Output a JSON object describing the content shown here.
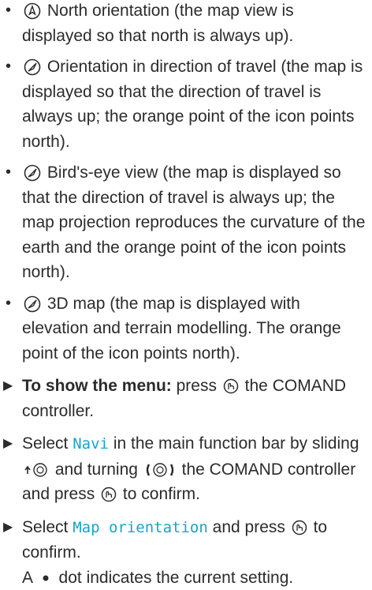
{
  "bullets": [
    {
      "icon": "north-orientation-icon",
      "text": "North orientation (the map view is displayed so that north is always up)."
    },
    {
      "icon": "compass-icon",
      "text": "Orientation in direction of travel (the map is displayed so that the direction of travel is always up; the orange point of the icon points north)."
    },
    {
      "icon": "compass-icon",
      "text": "Bird's-eye view (the map is displayed so that the direction of travel is always up; the map projection reproduces the curvature of the earth and the orange point of the icon points north)."
    },
    {
      "icon": "compass-icon",
      "text": "3D map (the map is displayed with elevation and terrain modelling. The orange point of the icon points north)."
    }
  ],
  "steps": {
    "show_menu": {
      "label": "To show the menu:",
      "text_1": "press",
      "text_2": "the COMAND controller."
    },
    "select_navi": {
      "text_1": "Select",
      "term": "Navi",
      "text_2": "in the main function bar by sliding",
      "text_3": "and turning",
      "text_4": "the COMAND controller and press",
      "text_5": "to confirm."
    },
    "select_map": {
      "text_1": "Select",
      "term": "Map orientation",
      "text_2": "and press",
      "text_3": "to confirm."
    }
  },
  "note": {
    "text_1": "A",
    "text_2": "dot indicates the current setting."
  }
}
